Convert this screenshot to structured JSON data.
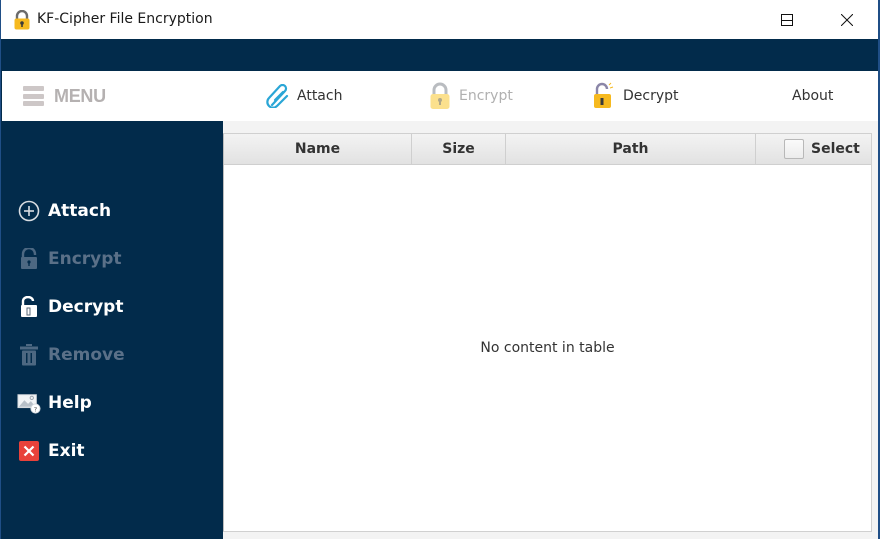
{
  "window": {
    "title": "KF-Cipher File Encryption",
    "controls": {
      "minimize": "minimize",
      "maximize": "maximize",
      "close": "close"
    }
  },
  "menu_header": {
    "label": "MENU",
    "icon": "hamburger-icon"
  },
  "toolbar": {
    "items": [
      {
        "label": "Attach",
        "icon": "paperclip-icon",
        "enabled": true
      },
      {
        "label": "Encrypt",
        "icon": "padlock-closed-icon",
        "enabled": false
      },
      {
        "label": "Decrypt",
        "icon": "padlock-open-icon",
        "enabled": true
      },
      {
        "label": "About",
        "icon": "",
        "enabled": true
      }
    ]
  },
  "sidebar": {
    "items": [
      {
        "label": "Attach",
        "icon": "plus-circle-icon",
        "enabled": true
      },
      {
        "label": "Encrypt",
        "icon": "lock-icon",
        "enabled": false
      },
      {
        "label": "Decrypt",
        "icon": "unlock-icon",
        "enabled": true
      },
      {
        "label": "Remove",
        "icon": "trash-icon",
        "enabled": false
      },
      {
        "label": "Help",
        "icon": "help-image-icon",
        "enabled": true
      },
      {
        "label": "Exit",
        "icon": "exit-x-icon",
        "enabled": true
      }
    ]
  },
  "table": {
    "columns": [
      "Name",
      "Size",
      "Path",
      "Select"
    ],
    "select_all_checked": false,
    "rows": [],
    "empty_message": "No content in table"
  },
  "colors": {
    "navy": "#022b4b",
    "disabled_text": "#5a7088",
    "exit_red": "#e8423b",
    "lock_yellow": "#f6b91f"
  }
}
